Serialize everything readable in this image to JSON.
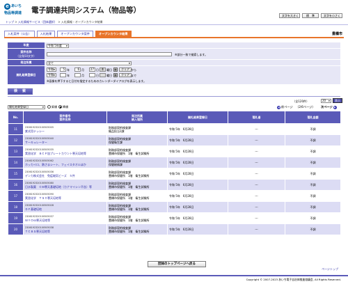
{
  "header": {
    "logo_mark": "e",
    "logo_top": "あいち",
    "logo_bottom": "物品等調達",
    "system_title": "電子調達共同システム（物品等）",
    "buttons": [
      "文字を大きく",
      "標　準",
      "文字を小さく"
    ]
  },
  "breadcrumb": {
    "items": [
      "トップ",
      "入札情報サービス（団体選択）",
      "入札情報・オープンカウンタ結果"
    ],
    "sep": ">"
  },
  "tabs": [
    "入札案件（公告）",
    "入札結果",
    "オープンカウンタ案件",
    "オープンカウンタ結果"
  ],
  "org_name": "豊橋市",
  "form": {
    "fiscal_year_label": "年度",
    "fiscal_year_value": "令和 5年度",
    "case_name_label": "案件名称",
    "case_name_sub": "（全角50文字）",
    "case_name_value": "",
    "case_name_note": "※部分一致で検索します。",
    "dept_label": "発注所属",
    "dept_value": "全て",
    "date_label": "開札結果登録日",
    "era": "令和",
    "from": {
      "year": "5",
      "month": "6",
      "day": "27",
      "cal": "木",
      "weekday_label": "曜日",
      "clear": "クリア",
      "suffix": "から"
    },
    "to": {
      "year": "",
      "month": "",
      "day": "",
      "cal": "",
      "weekday_label": "曜日",
      "clear": "クリア",
      "suffix": "まで"
    },
    "unit_year": "年",
    "unit_month": "月",
    "unit_day": "日",
    "date_note": "※画像を押下すると日付を指定するためのカレンダーダイアログを表示します。",
    "search_button": "検　索"
  },
  "list": {
    "count_text": "（全120件）",
    "per_page": "20",
    "per_page_go": "表示",
    "sort_value": "開札結果登録日",
    "radio_asc": "昇順",
    "radio_desc": "降順",
    "prev_label": "前ページ",
    "page_info": "（2/6ページ）",
    "next_label": "次ページ"
  },
  "table": {
    "headers": {
      "no": "No.",
      "anken_1": "案件番号",
      "anken_2": "案件名称",
      "dept_1": "発注所属",
      "dept_2": "納入場所",
      "date": "開札結果登録日",
      "winner": "落札者",
      "amount": "落札金額"
    },
    "rows": [
      {
        "no": "11",
        "anken_no": "2306192320100505005",
        "anken_name": "紫式用テッシー",
        "dept": "財務部契約検査課",
        "place": "備品担当1課",
        "date": "令和 5年　6月28日",
        "winner": "---",
        "amount": "不調"
      },
      {
        "no": "12",
        "anken_no": "2306192320100505040",
        "anken_name": "サーキュレーター",
        "dept": "財務部契約検査課",
        "place": "保健衛生課",
        "date": "令和 5年　6月28日",
        "winner": "---",
        "amount": "不調"
      },
      {
        "no": "13",
        "anken_no": "2306192320100505035",
        "anken_name": "実習化学　ＢＣＰ加プレートカウント寒天培地等",
        "dept": "財務部契約検査課",
        "place": "豊橋市保健所　1階　衛生試験所",
        "date": "令和 5年　6月28日",
        "winner": "---",
        "amount": "不調"
      },
      {
        "no": "14",
        "anken_no": "2306192320100505062",
        "anken_name": "ホッカイロ、熱さまシート、フェイスタオルほか",
        "dept": "財務部契約検査課",
        "place": "保健総務課",
        "date": "令和 5年　6月28日",
        "winner": "---",
        "amount": "不調"
      },
      {
        "no": "15",
        "anken_no": "2306192320100505036",
        "anken_name": "デンカ株式会社　免疫磁気ビーズ　５件",
        "dept": "財務部契約検査課",
        "place": "豊橋市保健所　1階　衛生試験所",
        "date": "令和 5年　6月28日",
        "winner": "---",
        "amount": "不調"
      },
      {
        "no": "16",
        "anken_no": "2306192320100505080",
        "anken_name": "日水製薬　ＣＷ寒天基礎培地（カナマイシン不含）等",
        "dept": "財務部契約検査課",
        "place": "豊橋市保健所　1階　衛生試験所",
        "date": "令和 5年　6月28日",
        "winner": "---",
        "amount": "不調"
      },
      {
        "no": "17",
        "anken_no": "2306192320100505090",
        "anken_name": "実習化学　ＴＳＩ寒天培地等",
        "dept": "財務部契約検査課",
        "place": "豊橋市保健所　1階　衛生試験所",
        "date": "令和 5年　6月28日",
        "winner": "---",
        "amount": "不調"
      },
      {
        "no": "18",
        "anken_no": "2306192320100505028",
        "anken_name": "ＤＦ基礎培地",
        "dept": "財務部契約検査課",
        "place": "豊橋市保健所　1階　衛生試験所",
        "date": "令和 5年　6月28日",
        "winner": "---",
        "amount": "不調"
      },
      {
        "no": "19",
        "anken_no": "2306192320100505037",
        "anken_name": "ＷＹＯss寒天培地等",
        "dept": "財務部契約検査課",
        "place": "豊橋市保健所　1階　衛生試験所",
        "date": "令和 5年　6月28日",
        "winner": "---",
        "amount": "不調"
      },
      {
        "no": "20",
        "anken_no": "2306192320100505038",
        "anken_name": "ＴＣＢＳ寒天培地等",
        "dept": "財務部契約検査課",
        "place": "豊橋市保健所　1階　衛生試験所",
        "date": "令和 5年　6月28日",
        "winner": "---",
        "amount": "不調"
      }
    ]
  },
  "footer": {
    "top_button": "団体のトップページへ戻る",
    "page_top": "ページトップ",
    "copyright": "Copyright © 2007-2023 あいち電子自治体推進協議会, All Rights Reserved."
  },
  "colors": {
    "accent": "#5a5ab8",
    "tab_active": "#e8742a",
    "row_alt": "#dcdcf4",
    "link": "#2a2aa5"
  }
}
